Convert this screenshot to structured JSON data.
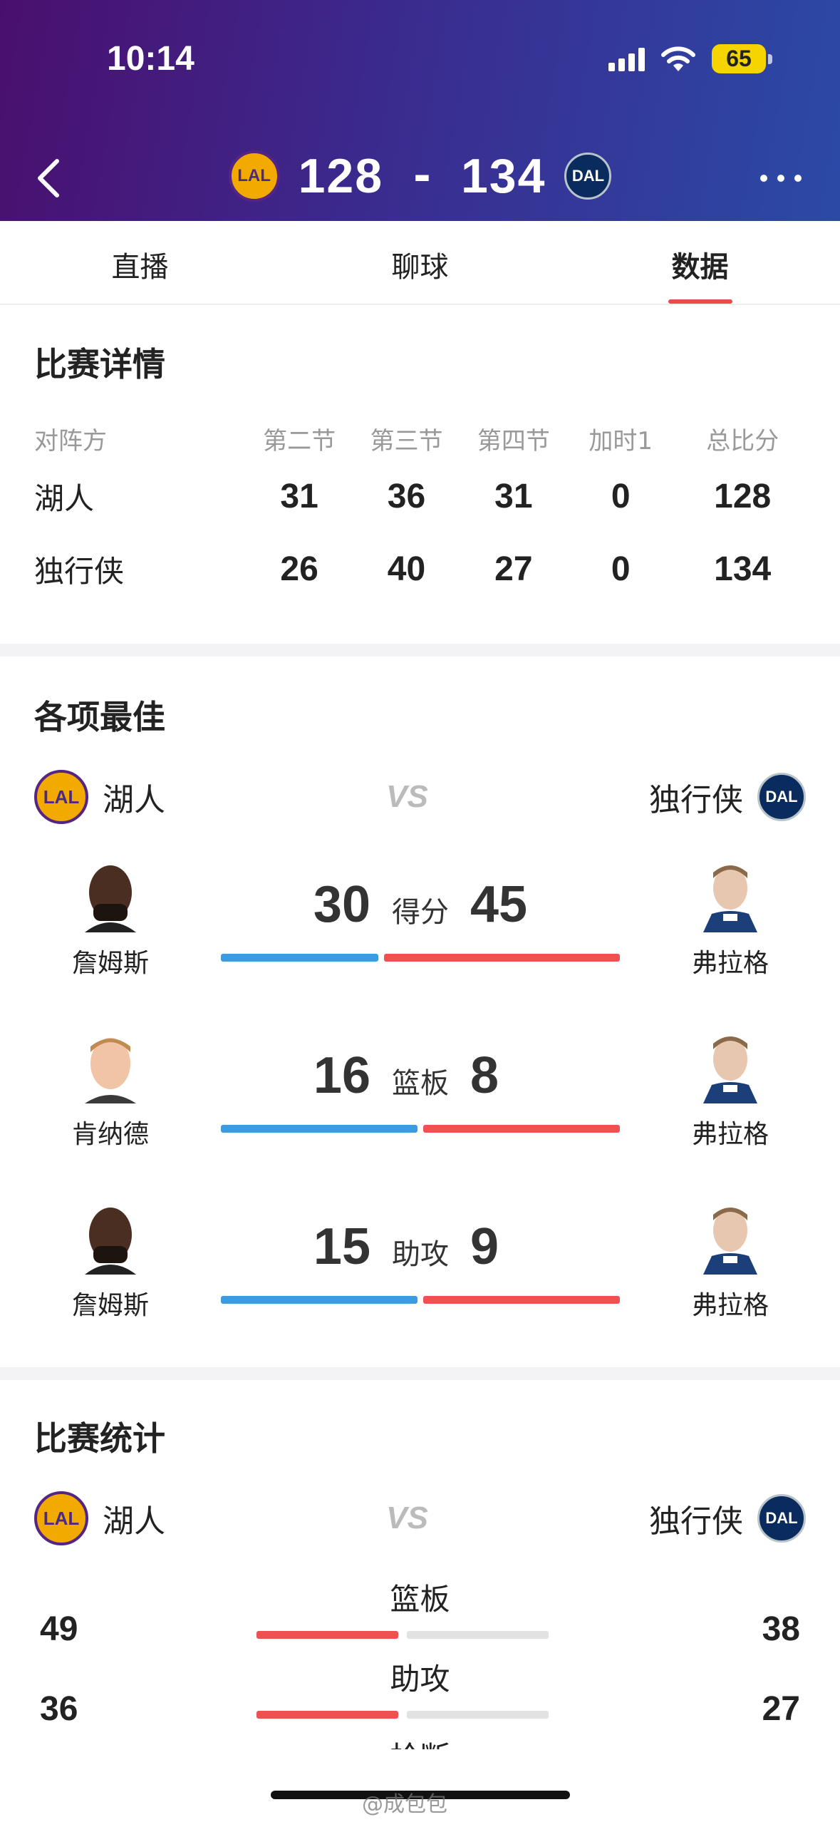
{
  "status_bar": {
    "time": "10:14",
    "battery": "65"
  },
  "header": {
    "home_score": "128",
    "dash": "-",
    "away_score": "134",
    "home_logo": "LAL",
    "away_logo": "DAL"
  },
  "tabs": [
    {
      "label": "直播",
      "active": false
    },
    {
      "label": "聊球",
      "active": false
    },
    {
      "label": "数据",
      "active": true
    }
  ],
  "match_detail": {
    "title": "比赛详情",
    "columns": [
      "对阵方",
      "第二节",
      "第三节",
      "第四节",
      "加时1",
      "总比分"
    ],
    "rows": [
      {
        "team": "湖人",
        "values": [
          "31",
          "36",
          "31",
          "0",
          "128"
        ]
      },
      {
        "team": "独行侠",
        "values": [
          "26",
          "40",
          "27",
          "0",
          "134"
        ]
      }
    ]
  },
  "leaders": {
    "title": "各项最佳",
    "home_team": "湖人",
    "away_team": "独行侠",
    "vs": "VS",
    "rows": [
      {
        "label": "得分",
        "home_player": "詹姆斯",
        "home_value": "30",
        "away_player": "弗拉格",
        "away_value": "45",
        "home_share": 0.4,
        "away_share": 0.6
      },
      {
        "label": "篮板",
        "home_player": "肯纳德",
        "home_value": "16",
        "away_player": "弗拉格",
        "away_value": "8",
        "home_share": 0.5,
        "away_share": 0.5
      },
      {
        "label": "助攻",
        "home_player": "詹姆斯",
        "home_value": "15",
        "away_player": "弗拉格",
        "away_value": "9",
        "home_share": 0.5,
        "away_share": 0.5
      }
    ]
  },
  "team_stats": {
    "title": "比赛统计",
    "home_team": "湖人",
    "away_team": "独行侠",
    "vs": "VS",
    "rows": [
      {
        "label": "篮板",
        "home_value": "49",
        "away_value": "38",
        "home_fill": 1.0,
        "away_fill": 0.0
      },
      {
        "label": "助攻",
        "home_value": "36",
        "away_value": "27",
        "home_fill": 1.0,
        "away_fill": 0.0
      }
    ],
    "cut_label": "抢断"
  },
  "watermark": "@成包包",
  "colors": {
    "home_bar": "#3d9be0",
    "away_bar": "#ef5050",
    "accent": "#e94a4a"
  }
}
